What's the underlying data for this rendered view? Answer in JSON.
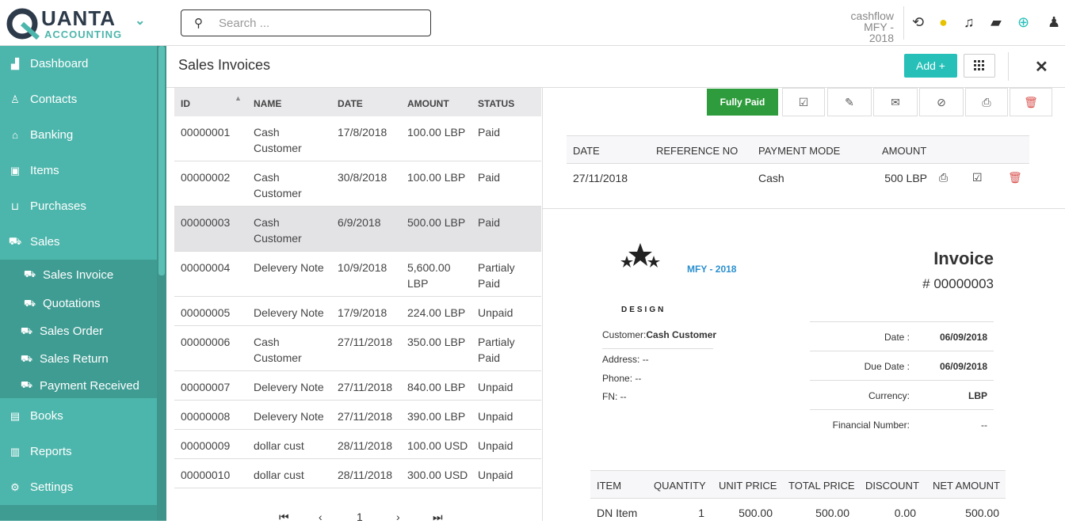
{
  "brand": {
    "logo_top": "UANTA",
    "logo_sub": "ACCOUNTING"
  },
  "header": {
    "search_placeholder": "Search ...",
    "company_line1": "cashflow",
    "company_line2": "MFY - 2018"
  },
  "sidebar": {
    "items": [
      {
        "label": "Dashboard",
        "icon": "area-chart-icon"
      },
      {
        "label": "Contacts",
        "icon": "user-icon"
      },
      {
        "label": "Banking",
        "icon": "bank-icon"
      },
      {
        "label": "Items",
        "icon": "archive-icon"
      },
      {
        "label": "Purchases",
        "icon": "basket-icon"
      },
      {
        "label": "Sales",
        "icon": "cart-icon"
      }
    ],
    "sub_items": [
      {
        "label": "Sales Invoice"
      },
      {
        "label": "Quotations"
      },
      {
        "label": "Sales Order"
      },
      {
        "label": "Sales Return"
      },
      {
        "label": "Payment Received"
      }
    ],
    "items2": [
      {
        "label": "Books"
      },
      {
        "label": "Reports"
      },
      {
        "label": "Settings"
      }
    ]
  },
  "page": {
    "title": "Sales Invoices",
    "add_label": "Add +"
  },
  "list": {
    "columns": [
      "ID",
      "NAME",
      "DATE",
      "AMOUNT",
      "STATUS"
    ],
    "rows": [
      {
        "id": "00000001",
        "name": "Cash",
        "name2": "Customer",
        "date": "17/8/2018",
        "amount": "100.00 LBP",
        "amount2": "",
        "status": "Paid",
        "status2": ""
      },
      {
        "id": "00000002",
        "name": "Cash",
        "name2": "Customer",
        "date": "30/8/2018",
        "amount": "100.00 LBP",
        "amount2": "",
        "status": "Paid",
        "status2": ""
      },
      {
        "id": "00000003",
        "name": "Cash",
        "name2": "Customer",
        "date": "6/9/2018",
        "amount": "500.00 LBP",
        "amount2": "",
        "status": "Paid",
        "status2": ""
      },
      {
        "id": "00000004",
        "name": "Delevery Note",
        "name2": "",
        "date": "10/9/2018",
        "amount": "5,600.00",
        "amount2": "LBP",
        "status": "Partialy",
        "status2": "Paid"
      },
      {
        "id": "00000005",
        "name": "Delevery Note",
        "name2": "",
        "date": "17/9/2018",
        "amount": "224.00 LBP",
        "amount2": "",
        "status": "Unpaid",
        "status2": ""
      },
      {
        "id": "00000006",
        "name": "Cash",
        "name2": "Customer",
        "date": "27/11/2018",
        "amount": "350.00 LBP",
        "amount2": "",
        "status": "Partialy",
        "status2": "Paid"
      },
      {
        "id": "00000007",
        "name": "Delevery Note",
        "name2": "",
        "date": "27/11/2018",
        "amount": "840.00 LBP",
        "amount2": "",
        "status": "Unpaid",
        "status2": ""
      },
      {
        "id": "00000008",
        "name": "Delevery Note",
        "name2": "",
        "date": "27/11/2018",
        "amount": "390.00 LBP",
        "amount2": "",
        "status": "Unpaid",
        "status2": ""
      },
      {
        "id": "00000009",
        "name": "dollar cust",
        "name2": "",
        "date": "28/11/2018",
        "amount": "100.00 USD",
        "amount2": "",
        "status": "Unpaid",
        "status2": ""
      },
      {
        "id": "00000010",
        "name": "dollar cust",
        "name2": "",
        "date": "28/11/2018",
        "amount": "300.00 USD",
        "amount2": "",
        "status": "Unpaid",
        "status2": ""
      }
    ],
    "page_number": "1"
  },
  "toolbar": {
    "fully_paid_label": "Fully Paid"
  },
  "payments": {
    "columns": [
      "DATE",
      "REFERENCE NO",
      "PAYMENT MODE",
      "AMOUNT"
    ],
    "row": {
      "date": "27/11/2018",
      "reference": "",
      "mode": "Cash",
      "amount": "500 LBP"
    }
  },
  "invoice": {
    "design_label": "DESIGN",
    "fiscal_year": "MFY - 2018",
    "title": "Invoice",
    "number": "# 00000003",
    "customer_label": "Customer:",
    "customer_name": "Cash Customer",
    "address": "Address: --",
    "phone": "Phone: --",
    "fn": "FN: --",
    "date_label": "Date :",
    "date_value": "06/09/2018",
    "due_label": "Due Date :",
    "due_value": "06/09/2018",
    "currency_label": "Currency:",
    "currency_value": "LBP",
    "fin_label": "Financial Number:",
    "fin_value": "--",
    "item_columns": [
      "ITEM",
      "QUANTITY",
      "UNIT PRICE",
      "TOTAL PRICE",
      "DISCOUNT",
      "NET AMOUNT"
    ],
    "item_row": {
      "item": "DN Item",
      "quantity": "1",
      "unit_price": "500.00",
      "total_price": "500.00",
      "discount": "0.00",
      "net_amount": "500.00"
    }
  }
}
